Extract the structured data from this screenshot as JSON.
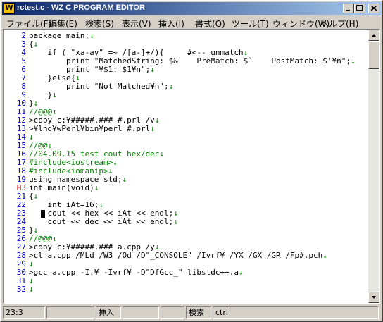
{
  "window": {
    "title": "rctest.c - WZ C PROGRAM EDITOR",
    "icon_label": "W"
  },
  "menu": [
    "ファイル(F)",
    "編集(E)",
    "検索(S)",
    "表示(V)",
    "挿入(I)",
    "書式(O)",
    "ツール(T)",
    "ウィンドウ(W)",
    "ヘルプ(H)"
  ],
  "editor": {
    "lines": [
      {
        "num": "2",
        "text": "package main;"
      },
      {
        "num": "3",
        "text": "{"
      },
      {
        "num": "4",
        "text": "    if ( \"xa-ay\" =~ /[a-]+/){     #<-- unmatch"
      },
      {
        "num": "5",
        "text": "        print \"MatchedString: $&    PreMatch: $`    PostMatch: $'¥n\";"
      },
      {
        "num": "6",
        "text": "        print \"¥$1: $1¥n\";"
      },
      {
        "num": "7",
        "text": "    }else{"
      },
      {
        "num": "8",
        "text": "        print \"Not Matched¥n\";"
      },
      {
        "num": "9",
        "text": "    }"
      },
      {
        "num": "10",
        "text": "}"
      },
      {
        "num": "11",
        "text": "//@@@"
      },
      {
        "num": "12",
        "text": ">copy c:¥#####.### #.prl /v"
      },
      {
        "num": "13",
        "text": ">¥lng¥wPerl¥bin¥perl #.prl"
      },
      {
        "num": "14",
        "text": ""
      },
      {
        "num": "15",
        "text": "//@@"
      },
      {
        "num": "16",
        "text": "//04.09.15 test cout hex/dec"
      },
      {
        "num": "17",
        "text": "#include<iostream>"
      },
      {
        "num": "18",
        "text": "#include<iomanip>"
      },
      {
        "num": "19",
        "text": "using namespace std;"
      },
      {
        "num": "H3",
        "text": "int main(void)"
      },
      {
        "num": "21",
        "text": "{"
      },
      {
        "num": "22",
        "text": "    int iAt=16;"
      },
      {
        "num": "23",
        "text": "    cout << hex << iAt << endl;"
      },
      {
        "num": "24",
        "text": "    cout << dec << iAt << endl;"
      },
      {
        "num": "25",
        "text": "}"
      },
      {
        "num": "26",
        "text": "//@@@"
      },
      {
        "num": "27",
        "text": ">copy c:¥#####.### a.cpp /y"
      },
      {
        "num": "28",
        "text": ">cl a.cpp /MLd /W3 /Od /D\"_CONSOLE\" /Ivrf¥ /YX /GX /GR /Fp#.pch"
      },
      {
        "num": "29",
        "text": ""
      },
      {
        "num": "30",
        "text": ">gcc a.cpp -I.¥ -Ivrf¥ -D\"DfGcc_\" libstdc++.a"
      },
      {
        "num": "31",
        "text": ""
      },
      {
        "num": "32",
        "text": ""
      }
    ],
    "eol_marker": "↓"
  },
  "status": {
    "position": "23:3",
    "insert_mode": "挿入",
    "search_label": "検索",
    "key_label": "ctrl"
  }
}
